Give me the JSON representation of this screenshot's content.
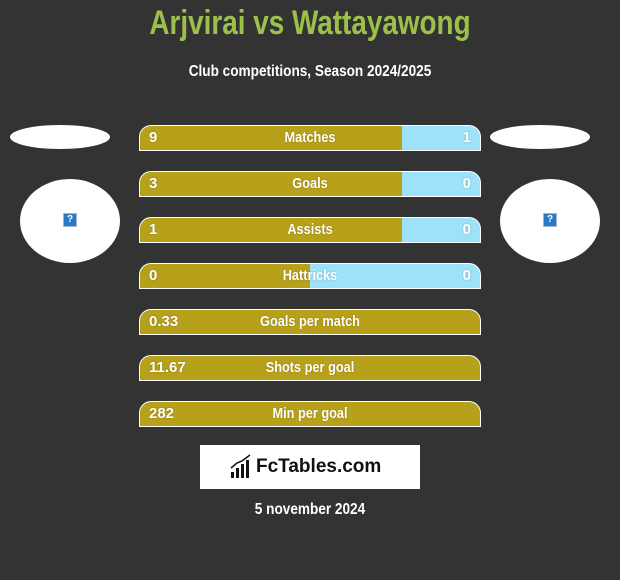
{
  "header": {
    "title": "Arjvirai vs Wattayawong",
    "subtitle": "Club competitions, Season 2024/2025"
  },
  "players": {
    "left": {
      "name": "Arjvirai",
      "avatar_icon": "broken-image-icon"
    },
    "right": {
      "name": "Wattayawong",
      "avatar_icon": "broken-image-icon"
    }
  },
  "colors": {
    "title": "#9cc14a",
    "left_bar": "#b8a11a",
    "right_bar": "#9ee2fa",
    "background": "#333333"
  },
  "stats": [
    {
      "label": "Matches",
      "left": "9",
      "right": "1",
      "left_share": 0.77
    },
    {
      "label": "Goals",
      "left": "3",
      "right": "0",
      "left_share": 0.77
    },
    {
      "label": "Assists",
      "left": "1",
      "right": "0",
      "left_share": 0.77
    },
    {
      "label": "Hattricks",
      "left": "0",
      "right": "0",
      "left_share": 0.5
    },
    {
      "label": "Goals per match",
      "left": "0.33",
      "right": "",
      "left_share": 1.0
    },
    {
      "label": "Shots per goal",
      "left": "11.67",
      "right": "",
      "left_share": 1.0
    },
    {
      "label": "Min per goal",
      "left": "282",
      "right": "",
      "left_share": 1.0
    }
  ],
  "brand": {
    "text": "FcTables.com",
    "icon": "bar-chart-icon"
  },
  "footer": {
    "date": "5 november 2024"
  }
}
